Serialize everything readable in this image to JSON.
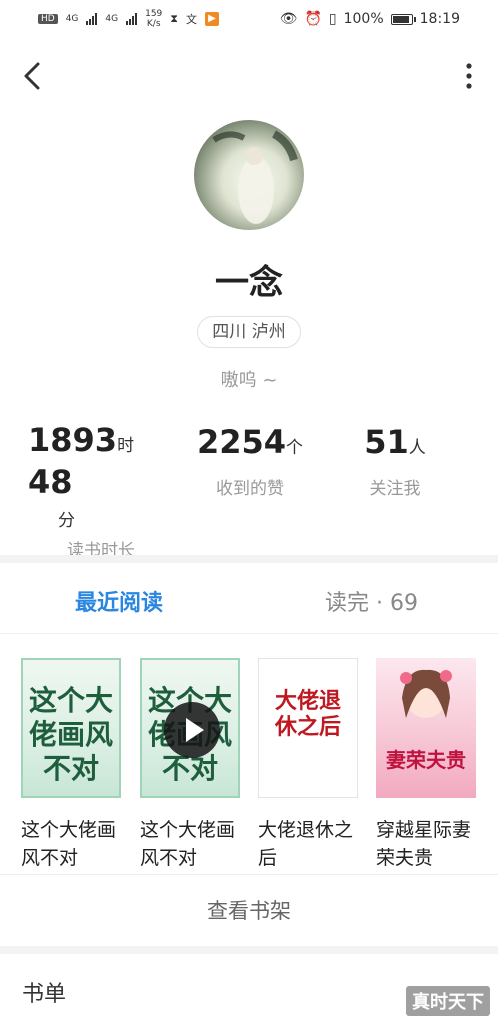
{
  "status_bar": {
    "hd": "HD",
    "net1": "4G",
    "net2": "4G",
    "speed": "159\nK/s",
    "battery_pct": "100%",
    "time": "18:19"
  },
  "profile": {
    "nickname": "一念",
    "location": "四川 泸州",
    "bio": "嗷呜 ~"
  },
  "stats": [
    {
      "value": "1893",
      "unit1": "时",
      "value2": "48",
      "unit2": "分",
      "label": "读书时长"
    },
    {
      "value": "2254",
      "unit": "个",
      "label": "收到的赞"
    },
    {
      "value": "51",
      "unit": "人",
      "label": "关注我"
    }
  ],
  "tabs": {
    "recent": "最近阅读",
    "finished": "读完 · 69"
  },
  "books": [
    {
      "title": "这个大佬画风不对",
      "cover_text": "这个大佬画风不对"
    },
    {
      "title": "这个大佬画风不对",
      "cover_text": "这个大佬画风不对"
    },
    {
      "title": "大佬退休之后",
      "cover_text": "大佬退休之后"
    },
    {
      "title": "穿越星际妻荣夫贵",
      "cover_text": "妻荣夫贵"
    }
  ],
  "shelf_button": "查看书架",
  "booklist_heading": "书单",
  "watermark": "真时天下",
  "colors": {
    "accent": "#2a86e0"
  }
}
